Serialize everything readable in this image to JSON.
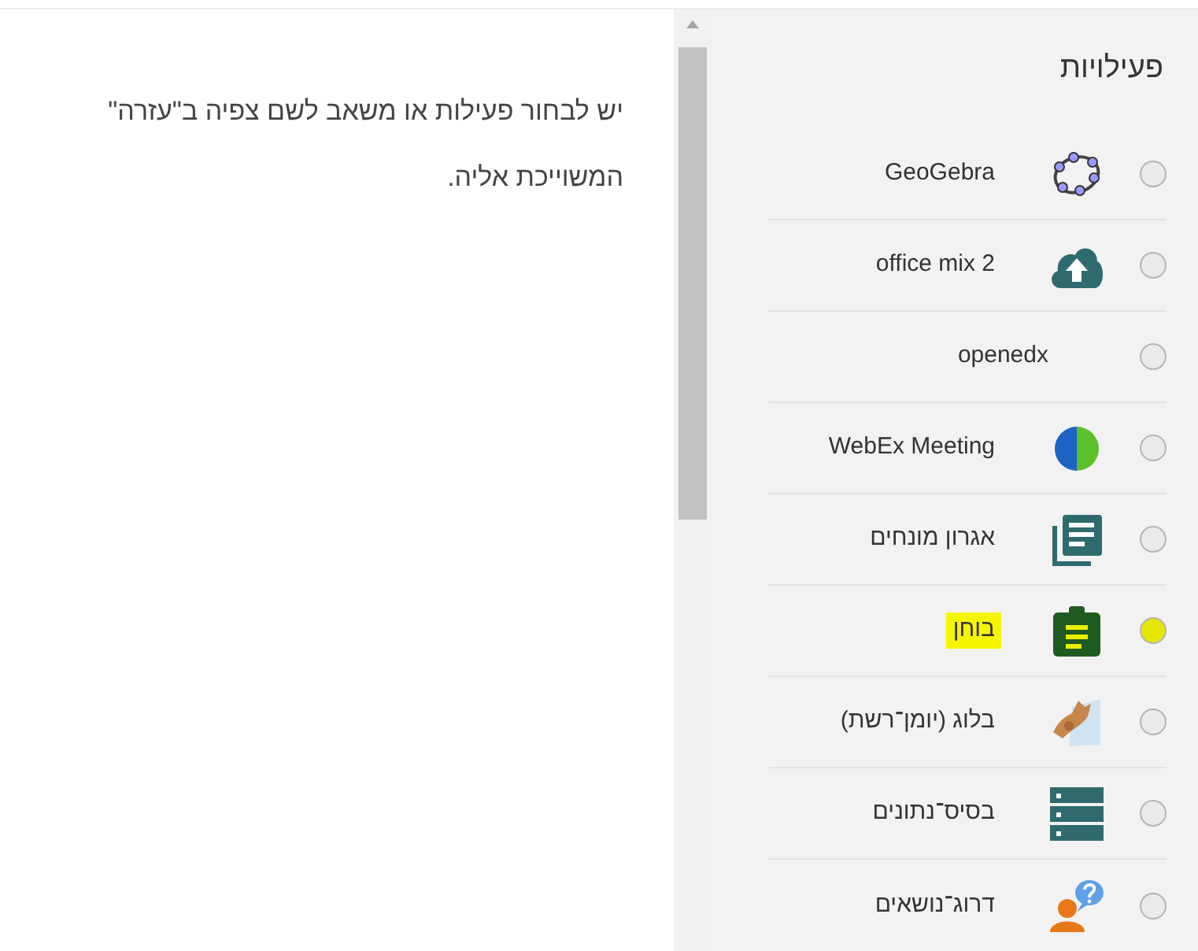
{
  "help_text": "יש לבחור פעילות או משאב לשם צפיה ב\"עזרה\" המשוייכת אליה.",
  "activities": {
    "heading": "פעילויות",
    "items": [
      {
        "label": "GeoGebra",
        "kind": "geogebra",
        "selected": false,
        "highlighted": false
      },
      {
        "label": "office mix 2",
        "kind": "cloud",
        "selected": false,
        "highlighted": false
      },
      {
        "label": "openedx",
        "kind": "none",
        "selected": false,
        "highlighted": false
      },
      {
        "label": "WebEx Meeting",
        "kind": "globe",
        "selected": false,
        "highlighted": false
      },
      {
        "label": "אגרון מונחים",
        "kind": "glossary",
        "selected": false,
        "highlighted": false
      },
      {
        "label": "בוחן",
        "kind": "quiz",
        "selected": false,
        "highlighted": true
      },
      {
        "label": "בלוג (יומן־רשת)",
        "kind": "blog",
        "selected": false,
        "highlighted": false
      },
      {
        "label": "בסיס־נתונים",
        "kind": "database",
        "selected": false,
        "highlighted": false
      },
      {
        "label": "דרוג־נושאים",
        "kind": "forum",
        "selected": false,
        "highlighted": false
      }
    ]
  }
}
